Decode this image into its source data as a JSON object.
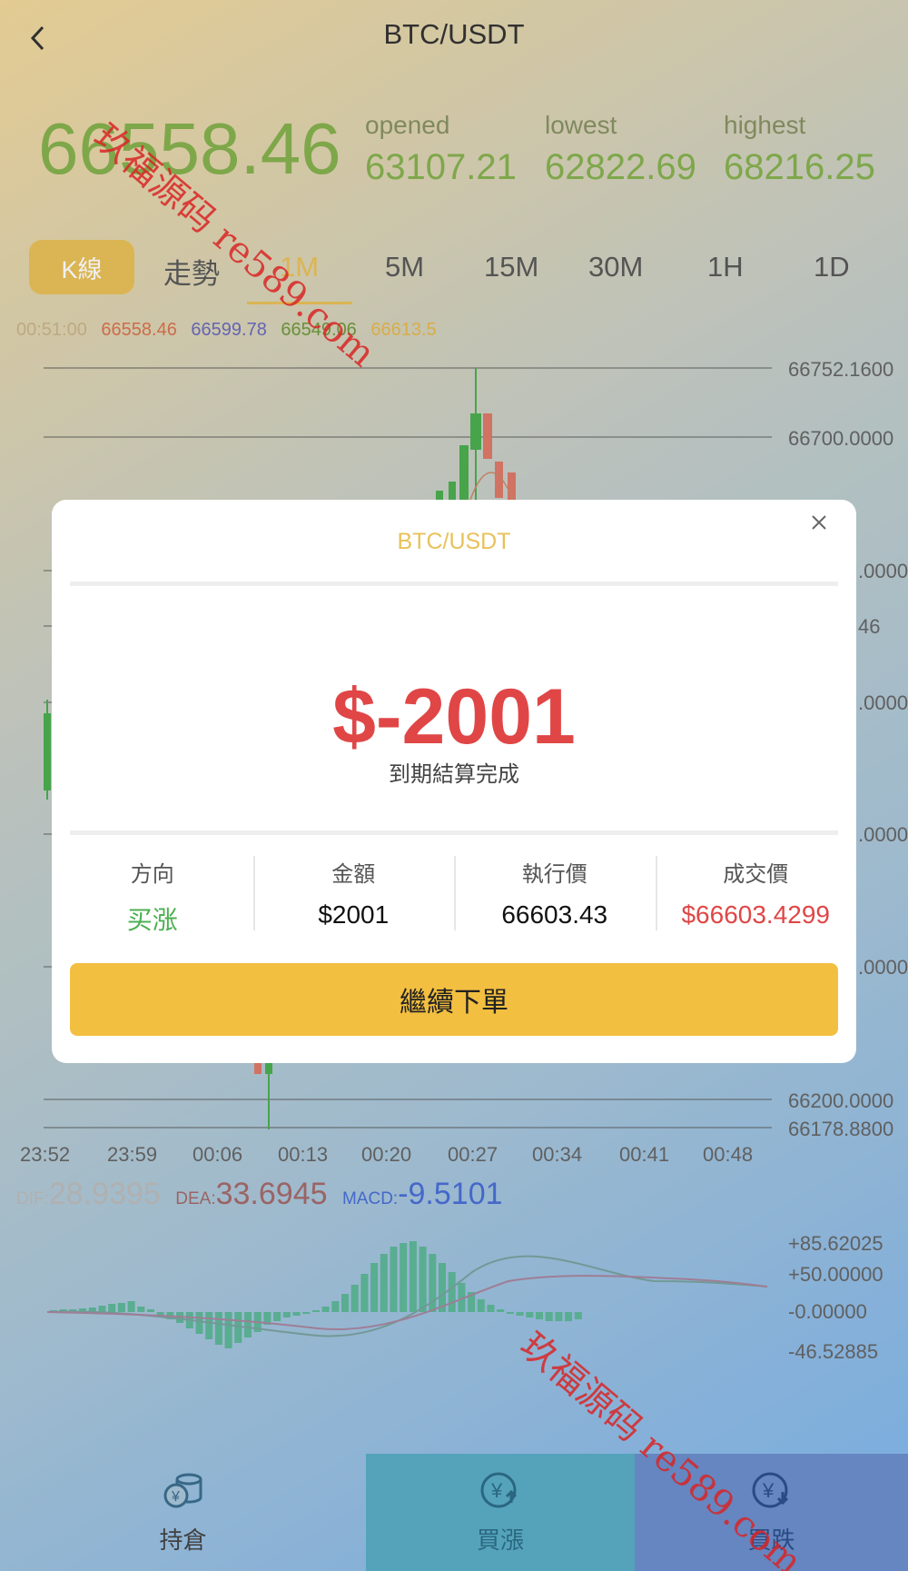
{
  "header": {
    "title": "BTC/USDT"
  },
  "price": {
    "current": "66558.46",
    "opened_label": "opened",
    "opened": "63107.21",
    "lowest_label": "lowest",
    "lowest": "62822.69",
    "highest_label": "highest",
    "highest": "68216.25"
  },
  "tabs": {
    "kline": "K線",
    "trend": "走勢",
    "intervals": [
      "1M",
      "5M",
      "15M",
      "30M",
      "1H",
      "1D"
    ],
    "active": "1M"
  },
  "ohlc": {
    "time": "00:51:00",
    "open": "66558.46",
    "high": "66599.78",
    "low": "66549.06",
    "close": "66613.5"
  },
  "price_axis": {
    "ticks": [
      "66752.1600",
      "66700.0000",
      "66200.0000",
      "66178.8800"
    ],
    "partial_ticks": [
      ".0000",
      "46",
      ".0000",
      ".0000",
      ".0000"
    ]
  },
  "time_axis": [
    "23:52",
    "23:59",
    "00:06",
    "00:13",
    "00:20",
    "00:27",
    "00:34",
    "00:41",
    "00:48"
  ],
  "indicators": {
    "dif_label": "DIF:",
    "dif": "28.9395",
    "dea_label": "DEA:",
    "dea": "33.6945",
    "macd_label": "MACD:",
    "macd": "-9.5101"
  },
  "macd_axis": [
    "+85.62025",
    "+50.00000",
    "-0.00000",
    "-46.52885"
  ],
  "bottom_nav": [
    {
      "label": "持倉",
      "icon": "coins-icon"
    },
    {
      "label": "買漲",
      "icon": "yen-up-icon"
    },
    {
      "label": "買跌",
      "icon": "yen-down-icon"
    }
  ],
  "modal": {
    "title": "BTC/USDT",
    "amount": "$-2001",
    "status": "到期結算完成",
    "columns": [
      {
        "label": "方向",
        "value": "买涨"
      },
      {
        "label": "金額",
        "value": "$2001"
      },
      {
        "label": "執行價",
        "value": "66603.43"
      },
      {
        "label": "成交價",
        "value": "$66603.4299"
      }
    ],
    "button": "繼續下單"
  },
  "watermark": "玖福源码 re589.com",
  "colors": {
    "accent": "#e9c15a",
    "up": "#4caf50",
    "down": "#e04646",
    "price_green": "#86b24f"
  }
}
